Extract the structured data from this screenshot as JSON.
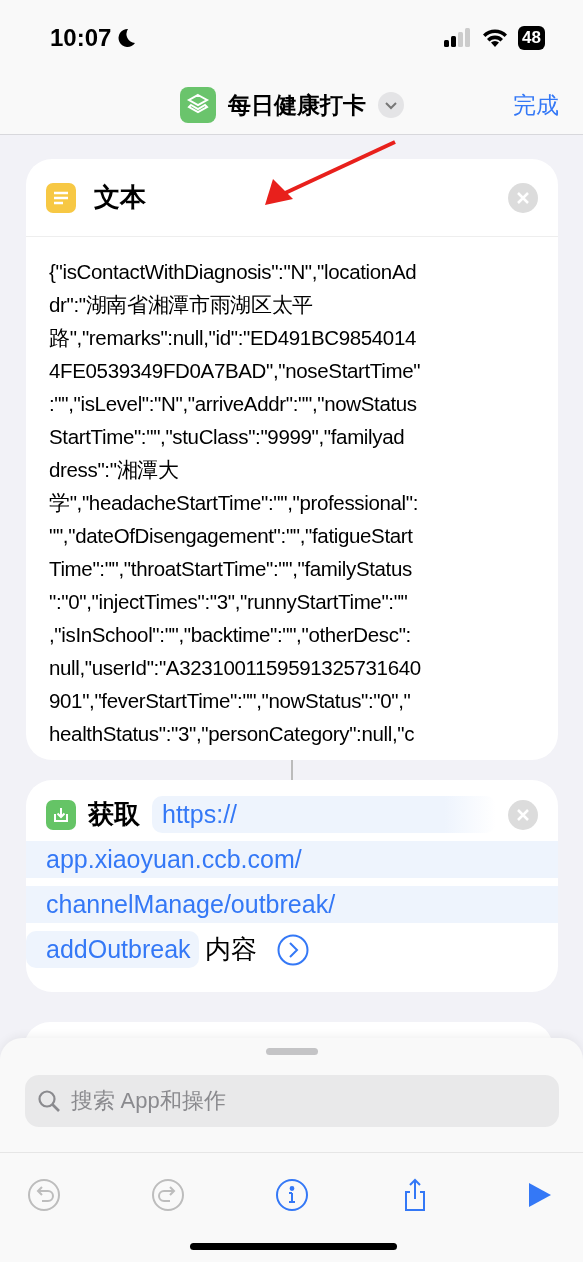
{
  "status_bar": {
    "time": "10:07",
    "battery": "48"
  },
  "nav": {
    "title": "每日健康打卡",
    "done": "完成"
  },
  "actions": [
    {
      "kind": "text",
      "title": "文本",
      "lines": [
        "{\"isContactWithDiagnosis\":\"N\",\"locationAd",
        "dr\":\"湖南省湘潭市雨湖区太平",
        "路\",\"remarks\":null,\"id\":\"ED491BC9854014",
        "4FE0539349FD0A7BAD\",\"noseStartTime\"",
        ":\"\",\"isLevel\":\"N\",\"arriveAddr\":\"\",\"nowStatus",
        "StartTime\":\"\",\"stuClass\":\"9999\",\"familyad",
        "dress\":\"湘潭大",
        "学\",\"headacheStartTime\":\"\",\"professional\":",
        "\"\",\"dateOfDisengagement\":\"\",\"fatigueStart",
        "Time\":\"\",\"throatStartTime\":\"\",\"familyStatus",
        "\":\"0\",\"injectTimes\":\"3\",\"runnyStartTime\":\"\"",
        ",\"isInSchool\":\"\",\"backtime\":\"\",\"otherDesc\":",
        "null,\"userId\":\"A3231001159591325731640",
        "901\",\"feverStartTime\":\"\",\"nowStatus\":\"0\",\"",
        "healthStatus\":\"3\",\"personCategory\":null,\"c"
      ]
    },
    {
      "kind": "fetch",
      "title": "获取",
      "url_lines": [
        "https://",
        "app.xiaoyuan.ccb.com/",
        "channelManage/outbreak/",
        "addOutbreak"
      ],
      "suffix": "内容"
    }
  ],
  "search": {
    "placeholder": "搜索 App和操作"
  },
  "toolbar": [
    {
      "kind": "undo",
      "disabled": true
    },
    {
      "kind": "redo",
      "disabled": true
    },
    {
      "kind": "info",
      "disabled": false
    },
    {
      "kind": "share",
      "disabled": false
    },
    {
      "kind": "run",
      "disabled": false
    }
  ]
}
